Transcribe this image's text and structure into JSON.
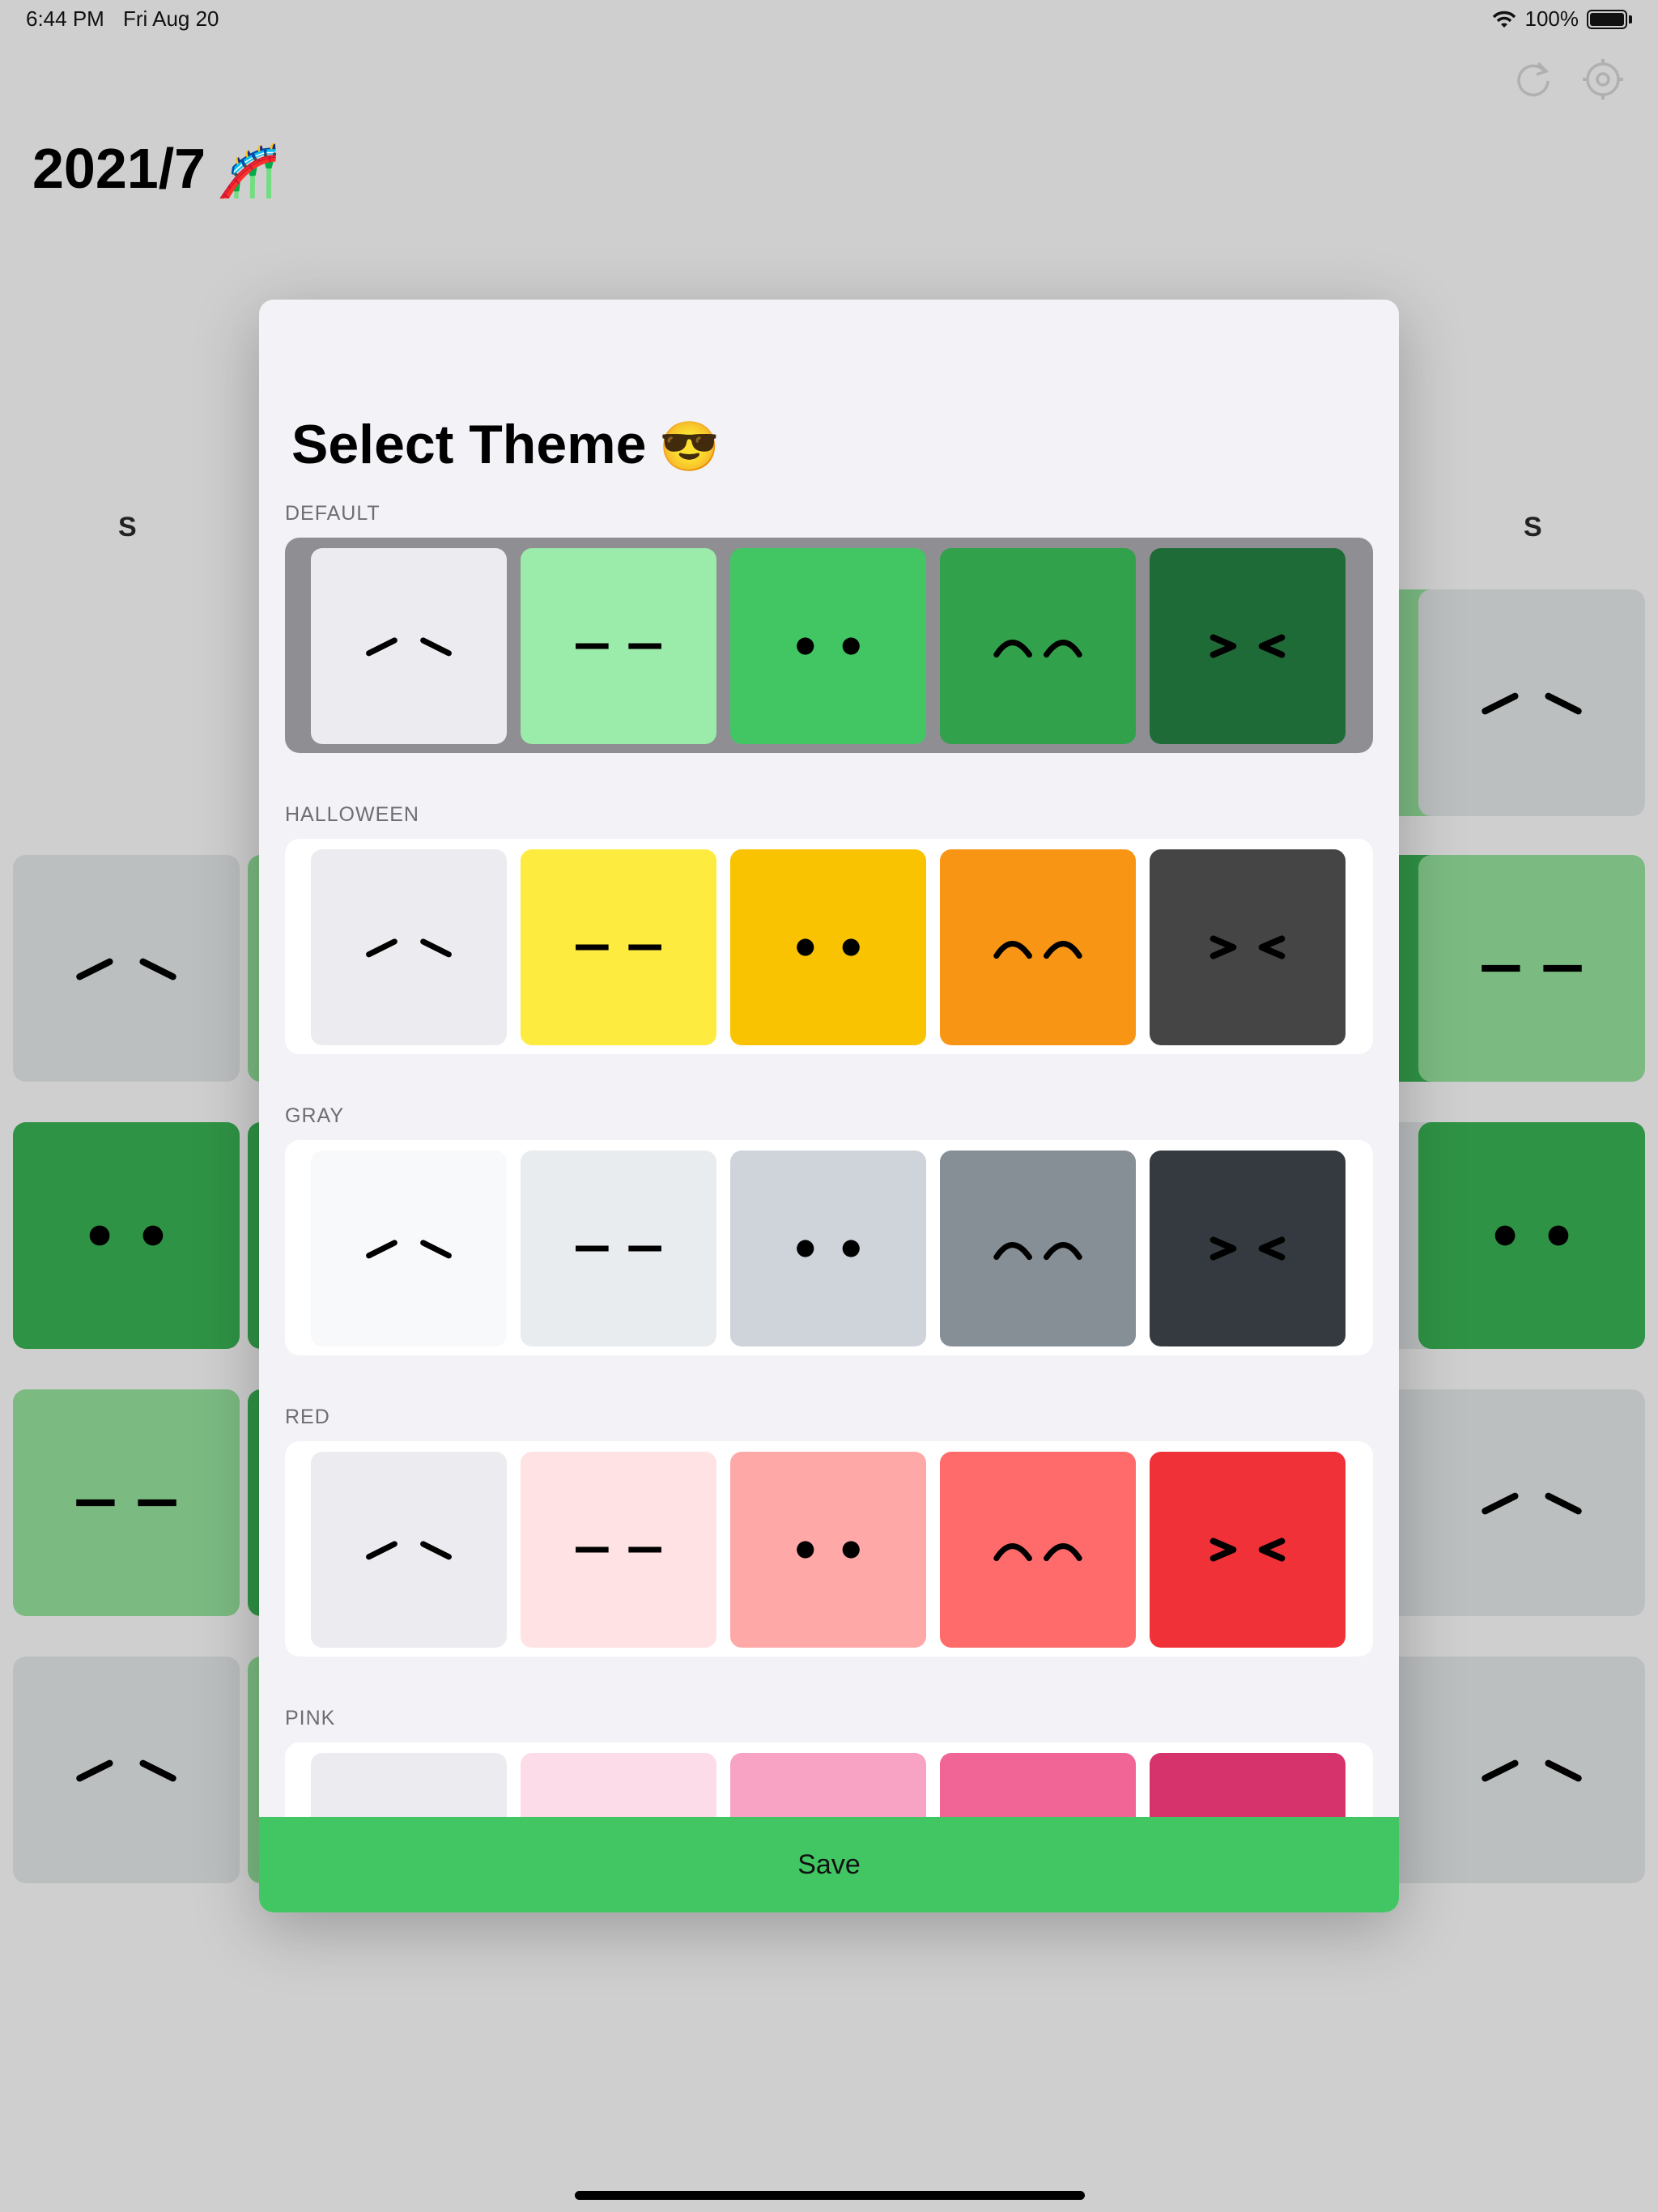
{
  "status_bar": {
    "time": "6:44 PM",
    "date": "Fri Aug 20",
    "battery": "100%"
  },
  "background": {
    "title": "2021/7",
    "title_emoji": "🎢",
    "weekdays": [
      "S",
      "S"
    ],
    "toolbar_icons": [
      "refresh-icon",
      "settings-icon"
    ]
  },
  "modal": {
    "title": "Select Theme",
    "title_emoji": "😎",
    "themes": [
      {
        "name": "DEFAULT",
        "selected": true,
        "colors": [
          "#ebebf0",
          "#9bebaa",
          "#42c663",
          "#31a14b",
          "#1f6b37"
        ]
      },
      {
        "name": "HALLOWEEN",
        "selected": false,
        "colors": [
          "#ebebf0",
          "#fdeb40",
          "#f9c301",
          "#f99515",
          "#454545"
        ]
      },
      {
        "name": "GRAY",
        "selected": false,
        "colors": [
          "#f8f9fb",
          "#e9ecef",
          "#ced4da",
          "#868e96",
          "#343a40"
        ]
      },
      {
        "name": "RED",
        "selected": false,
        "colors": [
          "#ebebf0",
          "#ffe2e3",
          "#ffa8a8",
          "#ff6b6b",
          "#f03137"
        ]
      },
      {
        "name": "PINK",
        "selected": false,
        "colors": [
          "#ebebf0",
          "#fddcea",
          "#f8a3c4",
          "#f06595",
          "#d6336c"
        ]
      }
    ],
    "faces": [
      "face-neutral-icon",
      "face-flat-icon",
      "face-dots-icon",
      "face-happy-icon",
      "face-squint-icon"
    ],
    "save_label": "Save"
  }
}
